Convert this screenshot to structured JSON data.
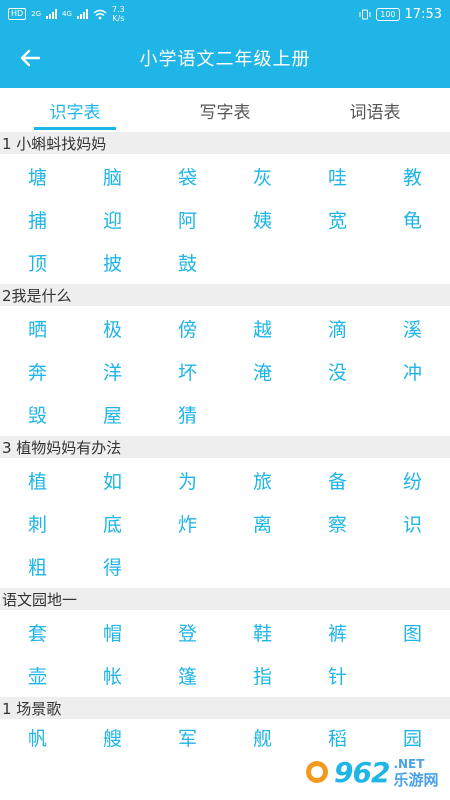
{
  "status_bar": {
    "hd_badge": "HD",
    "net_2g": "2G",
    "net_4g": "4G",
    "speed_value": "7.3",
    "speed_unit": "K/s",
    "battery": "100",
    "time": "17:53"
  },
  "header": {
    "title": "小学语文二年级上册"
  },
  "tabs": [
    {
      "label": "识字表"
    },
    {
      "label": "写字表"
    },
    {
      "label": "词语表"
    }
  ],
  "sections": [
    {
      "title": "1 小蝌蚪找妈妈",
      "chars": [
        "塘",
        "脑",
        "袋",
        "灰",
        "哇",
        "教",
        "捕",
        "迎",
        "阿",
        "姨",
        "宽",
        "龟",
        "顶",
        "披",
        "鼓"
      ]
    },
    {
      "title": "2我是什么",
      "chars": [
        "晒",
        "极",
        "傍",
        "越",
        "滴",
        "溪",
        "奔",
        "洋",
        "坏",
        "淹",
        "没",
        "冲",
        "毁",
        "屋",
        "猜"
      ]
    },
    {
      "title": "3 植物妈妈有办法",
      "chars": [
        "植",
        "如",
        "为",
        "旅",
        "备",
        "纷",
        "刺",
        "底",
        "炸",
        "离",
        "察",
        "识",
        "粗",
        "得"
      ]
    },
    {
      "title": "语文园地一",
      "chars": [
        "套",
        "帽",
        "登",
        "鞋",
        "裤",
        "图",
        "壶",
        "帐",
        "篷",
        "指",
        "针"
      ]
    },
    {
      "title": "1 场景歌",
      "chars": [
        "帆",
        "艘",
        "军",
        "舰",
        "稻",
        "园"
      ]
    }
  ],
  "watermark": {
    "logo": "962",
    "domain": ".NET",
    "site": "乐游网"
  },
  "colors": {
    "accent": "#1fb5e6",
    "section_bg": "#eeeeee"
  }
}
